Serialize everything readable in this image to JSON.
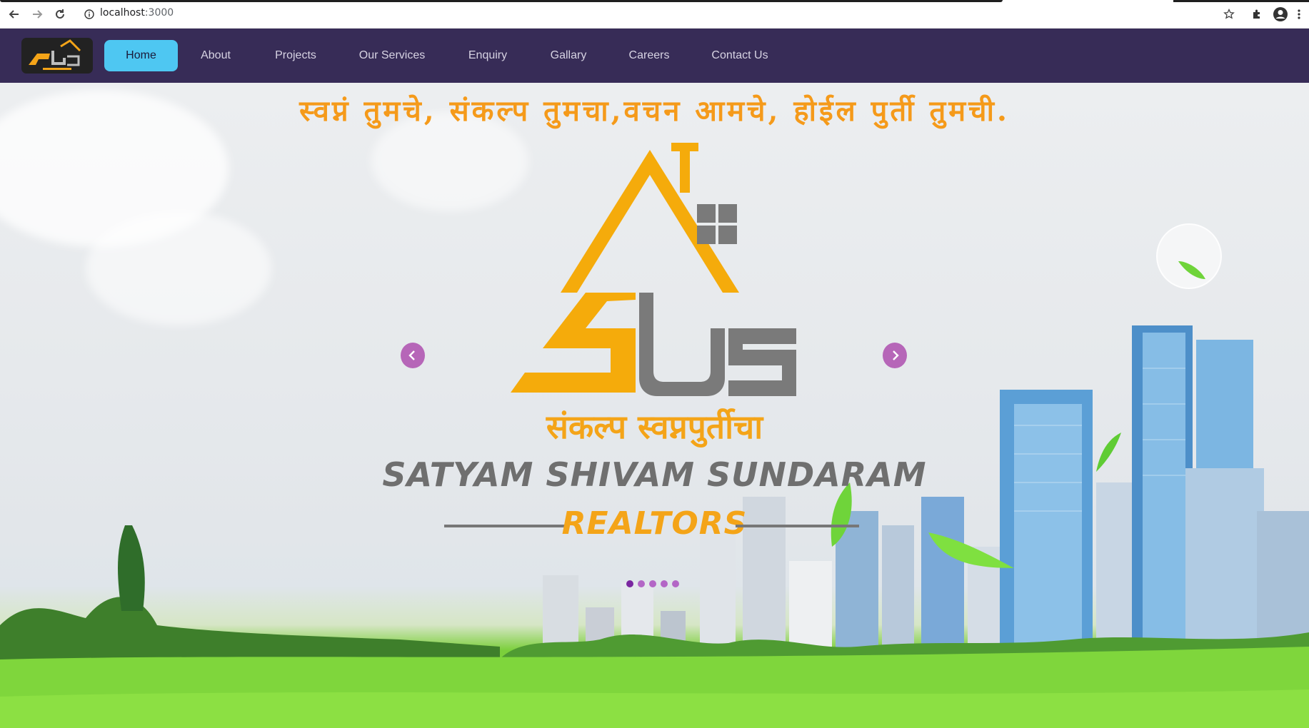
{
  "browser": {
    "url_host": "localhost",
    "url_port": ":3000",
    "icons": [
      "back-arrow-icon",
      "forward-arrow-icon",
      "reload-icon",
      "info-icon",
      "star-icon",
      "extension-puzzle-icon",
      "profile-icon",
      "kebab-menu-icon"
    ]
  },
  "nav": {
    "items": [
      {
        "label": "Home",
        "active": true
      },
      {
        "label": "About"
      },
      {
        "label": "Projects"
      },
      {
        "label": "Our Services"
      },
      {
        "label": "Enquiry"
      },
      {
        "label": "Gallary"
      },
      {
        "label": "Careers"
      },
      {
        "label": "Contact Us"
      }
    ]
  },
  "hero": {
    "slogan": "स्वप्नं तुमचे, संकल्प तुमचा,वचन आमचे, होईल पुर्ती तुमची.",
    "tagline_marathi": "संकल्प स्वप्नपुर्तीचा",
    "brand_name": "SATYAM SHIVAM SUNDARAM",
    "brand_sub": "REALTORS",
    "logo_text": "SSS",
    "slide_count": 5,
    "active_slide": 1
  },
  "colors": {
    "nav_bg": "#372c57",
    "active_tab": "#4ec7f2",
    "brand_orange": "#f4a418",
    "brand_gray": "#7a7a7a",
    "carousel_arrow": "#b666b8",
    "grass": "#7fd63c"
  }
}
